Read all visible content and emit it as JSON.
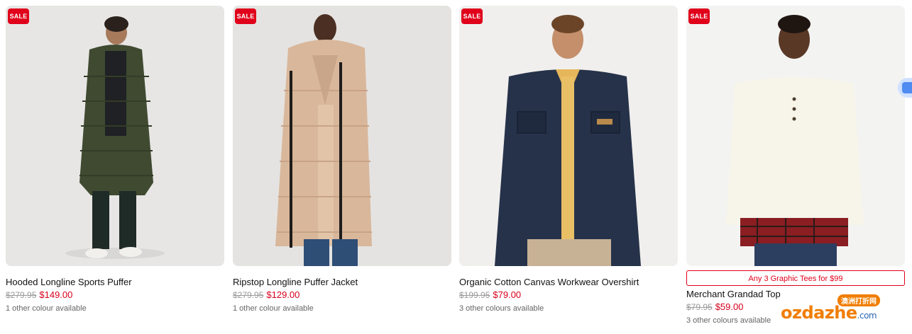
{
  "products": [
    {
      "badge": "SALE",
      "name": "Hooded Longline Sports Puffer",
      "was_price": "$279.95",
      "price": "$149.00",
      "colours": "1 other colour available"
    },
    {
      "badge": "SALE",
      "name": "Ripstop Longline Puffer Jacket",
      "was_price": "$279.95",
      "price": "$129.00",
      "colours": "1 other colour available"
    },
    {
      "badge": "SALE",
      "name": "Organic Cotton Canvas Workwear Overshirt",
      "was_price": "$199.95",
      "price": "$79.00",
      "colours": "3 other colours available"
    },
    {
      "badge": "SALE",
      "promo": "Any 3 Graphic Tees for $99",
      "name": "Merchant Grandad Top",
      "was_price": "$79.95",
      "price": "$59.00",
      "colours": "3 other colours available"
    }
  ],
  "watermark": {
    "cn_text": "澳洲打折网",
    "logo_text": "ozdazhe",
    "logo_suffix": ".com"
  },
  "colors": {
    "sale_red": "#e0001b",
    "price_red": "#d6001c",
    "watermark_orange": "#f07d00"
  }
}
